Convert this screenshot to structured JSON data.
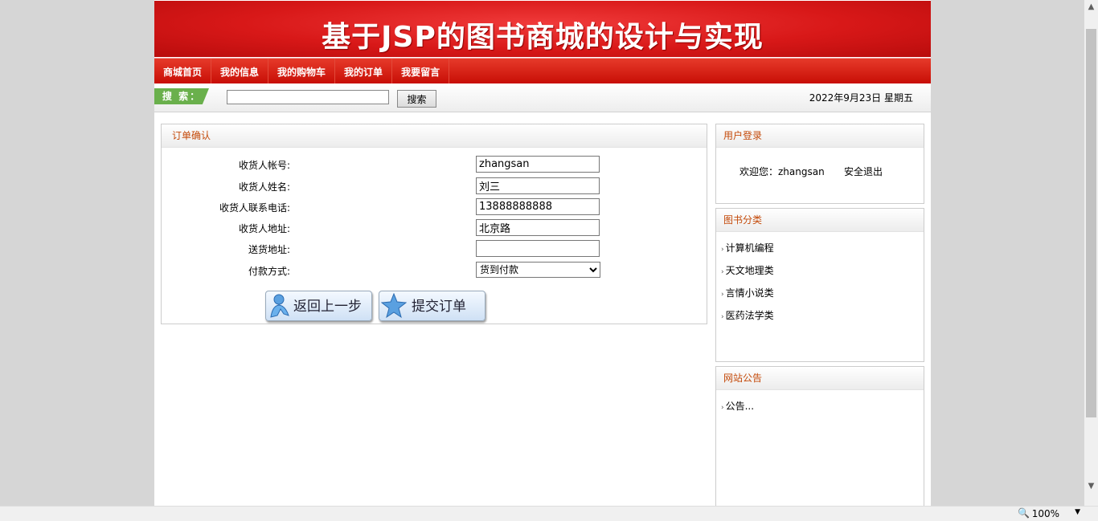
{
  "banner": {
    "title": "基于JSP的图书商城的设计与实现"
  },
  "nav": {
    "items": [
      "商城首页",
      "我的信息",
      "我的购物车",
      "我的订单",
      "我要留言"
    ]
  },
  "search": {
    "label": "搜 索：",
    "value": "",
    "button": "搜索",
    "date": "2022年9月23日 星期五"
  },
  "order": {
    "title": "订单确认",
    "fields": [
      {
        "label": "收货人帐号:",
        "value": "zhangsan"
      },
      {
        "label": "收货人姓名:",
        "value": "刘三"
      },
      {
        "label": "收货人联系电话:",
        "value": "13888888888"
      },
      {
        "label": "收货人地址:",
        "value": "北京路"
      },
      {
        "label": "送货地址:",
        "value": ""
      }
    ],
    "payment": {
      "label": "付款方式:",
      "selected": "货到付款"
    },
    "back_button": "返回上一步",
    "submit_button": "提交订单"
  },
  "login": {
    "title": "用户登录",
    "welcome": "欢迎您：zhangsan",
    "logout": "安全退出"
  },
  "categories": {
    "title": "图书分类",
    "items": [
      "计算机编程",
      "天文地理类",
      "言情小说类",
      "医药法学类"
    ]
  },
  "notice": {
    "title": "网站公告",
    "items": [
      "公告..."
    ]
  },
  "status": {
    "zoom": "100%"
  },
  "colors": {
    "banner": "#d81818",
    "nav": "#c80e06",
    "panel_title": "#c44a0a",
    "search_label": "#6ab04c"
  }
}
